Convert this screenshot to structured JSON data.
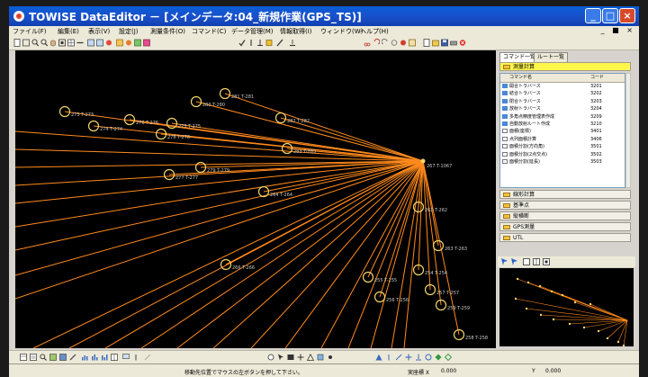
{
  "window": {
    "title": "TOWISE DataEditor － [メインデータ:04_新規作業(GPS_TS)]",
    "min_label": "_",
    "max_label": "□",
    "close_label": "×"
  },
  "menu": {
    "items": [
      "ファイル(F)",
      "編集(E)",
      "表示(V)",
      "設定(J)",
      "測量条件(O)",
      "コマンド(C)",
      "データ管理(M)",
      "情報取得(I)",
      "ウィンドウ(W)",
      "ヘルプ(H)"
    ],
    "mdi_controls": "_ ■ ×"
  },
  "canvas": {
    "background": "#000000",
    "line_color": "#ff8a1c",
    "marker_color": "#f3d46a",
    "label_color": "#c9c9c9",
    "hub_label": "267 T-1067",
    "points": [
      {
        "id": "tl-281",
        "label": "281 T-281"
      },
      {
        "id": "tl-280",
        "label": "280 T-280"
      },
      {
        "id": "tl-282",
        "label": "282 T-282"
      },
      {
        "id": "tl-276",
        "label": "276 T-276"
      },
      {
        "id": "tl-275",
        "label": "275 T-275"
      },
      {
        "id": "tl-274",
        "label": "274 T-274"
      },
      {
        "id": "tl-278",
        "label": "278 T-278"
      },
      {
        "id": "tl-273",
        "label": "273 T-273"
      },
      {
        "id": "tl-283",
        "label": "283 T-283"
      },
      {
        "id": "tl-277",
        "label": "277 T-277"
      },
      {
        "id": "tl-279",
        "label": "279 T-279"
      },
      {
        "id": "tl-264",
        "label": "264 T-264"
      },
      {
        "id": "tl-262",
        "label": "262 T-262"
      },
      {
        "id": "tl-263",
        "label": "263 T-263"
      },
      {
        "id": "tl-266",
        "label": "266 T-266"
      },
      {
        "id": "tl-254",
        "label": "254 T-254"
      },
      {
        "id": "tl-255",
        "label": "255 T-255"
      },
      {
        "id": "tl-257",
        "label": "257 T-257"
      },
      {
        "id": "tl-256",
        "label": "256 T-256"
      },
      {
        "id": "tl-259",
        "label": "259 T-259"
      },
      {
        "id": "tl-258",
        "label": "258 T-258"
      }
    ]
  },
  "right_panel": {
    "tabs": [
      "コマンド一覧",
      "ルート一覧"
    ],
    "active_category": "測量計算",
    "list_headers": {
      "name": "コマンド名",
      "code": "コード"
    },
    "rows": [
      {
        "name": "開合トラバース",
        "code": "3201"
      },
      {
        "name": "結合トラバース",
        "code": "3202"
      },
      {
        "name": "閉合トラバース",
        "code": "3203"
      },
      {
        "name": "放射トラバース",
        "code": "3204"
      },
      {
        "name": "多角点精度管理表作成",
        "code": "3209"
      },
      {
        "name": "自動放射ルート作成",
        "code": "3210"
      },
      {
        "name": "面積(座標)",
        "code": "3401"
      },
      {
        "name": "点列面積計算",
        "code": "3406"
      },
      {
        "name": "面積分割(方向角)",
        "code": "3501"
      },
      {
        "name": "面積分割(2点交点)",
        "code": "3502"
      },
      {
        "name": "面積分割(延長)",
        "code": "3503"
      }
    ],
    "categories": [
      "線形計算",
      "基準点",
      "縦横断",
      "GPS測量",
      "UTL"
    ]
  },
  "status": {
    "message": "移動先位置でマウスの左ボタンを押して下さい。",
    "field_x_label": "実座標 X",
    "field_x_value": "0.000",
    "field_y_label": "Y",
    "field_y_value": "0.000"
  }
}
